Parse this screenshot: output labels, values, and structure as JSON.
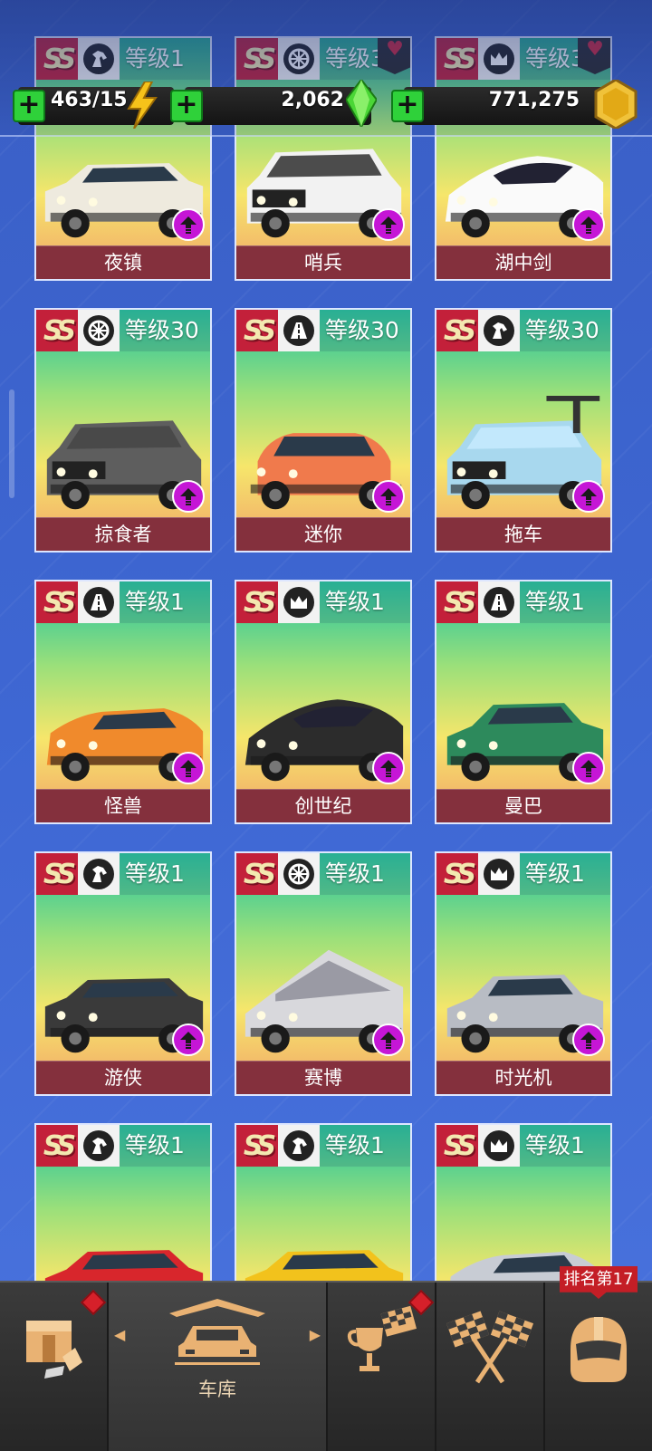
{
  "currencies": {
    "energy": "463/15",
    "gems": "2,062",
    "coins": "771,275"
  },
  "cars": [
    {
      "name": "夜镇",
      "level": "等级1",
      "class_icon": "horse-icon",
      "favorite": false,
      "body": "#eeeade",
      "roof": "#d9d4c4",
      "style": "muscle"
    },
    {
      "name": "哨兵",
      "level": "等级3",
      "class_icon": "wheel-icon",
      "favorite": true,
      "body": "#f2f2f2",
      "roof": "#222",
      "style": "truck"
    },
    {
      "name": "湖中剑",
      "level": "等级3",
      "class_icon": "crown-icon",
      "favorite": true,
      "body": "#fafafa",
      "roof": "#333",
      "style": "super"
    },
    {
      "name": "掠食者",
      "level": "等级30",
      "class_icon": "wheel-icon",
      "favorite": false,
      "body": "#5e5e5e",
      "roof": "#444",
      "style": "truck"
    },
    {
      "name": "迷你",
      "level": "等级30",
      "class_icon": "road-icon",
      "favorite": false,
      "body": "#f07a4c",
      "roof": "#e86a3c",
      "style": "mini"
    },
    {
      "name": "拖车",
      "level": "等级30",
      "class_icon": "horse-icon",
      "favorite": false,
      "body": "#a8d8ee",
      "roof": "#c8ecff",
      "style": "tow"
    },
    {
      "name": "怪兽",
      "level": "等级1",
      "class_icon": "road-icon",
      "favorite": false,
      "body": "#f08a2c",
      "roof": "#e07a1c",
      "style": "sport"
    },
    {
      "name": "创世纪",
      "level": "等级1",
      "class_icon": "crown-icon",
      "favorite": false,
      "body": "#2c2c2c",
      "roof": "#1a1a1a",
      "style": "super"
    },
    {
      "name": "曼巴",
      "level": "等级1",
      "class_icon": "road-icon",
      "favorite": false,
      "body": "#2d8a5c",
      "roof": "#246c48",
      "style": "classic"
    },
    {
      "name": "游侠",
      "level": "等级1",
      "class_icon": "horse-icon",
      "favorite": false,
      "body": "#3a3a3a",
      "roof": "#2c2c2c",
      "style": "muscle"
    },
    {
      "name": "赛博",
      "level": "等级1",
      "class_icon": "wheel-icon",
      "favorite": false,
      "body": "#d8d8dc",
      "roof": "#bcbcc2",
      "style": "cyber"
    },
    {
      "name": "时光机",
      "level": "等级1",
      "class_icon": "crown-icon",
      "favorite": false,
      "body": "#b8bcc4",
      "roof": "#9aa0aa",
      "style": "classic"
    },
    {
      "name": "",
      "level": "等级1",
      "class_icon": "horse-icon",
      "favorite": false,
      "body": "#d8262c",
      "roof": "#b81c22",
      "style": "muscle"
    },
    {
      "name": "",
      "level": "等级1",
      "class_icon": "horse-icon",
      "favorite": false,
      "body": "#f2c21c",
      "roof": "#222",
      "style": "muscle"
    },
    {
      "name": "",
      "level": "等级1",
      "class_icon": "crown-icon",
      "favorite": false,
      "body": "#c8ccd4",
      "roof": "#aab0ba",
      "style": "sport"
    }
  ],
  "nav": {
    "garage_label": "车库",
    "rank_tag": "排名第17"
  },
  "colors": {
    "upgrade": "#c516d6",
    "name_bar": "#84303d",
    "rank_badge": "#c3203a"
  }
}
